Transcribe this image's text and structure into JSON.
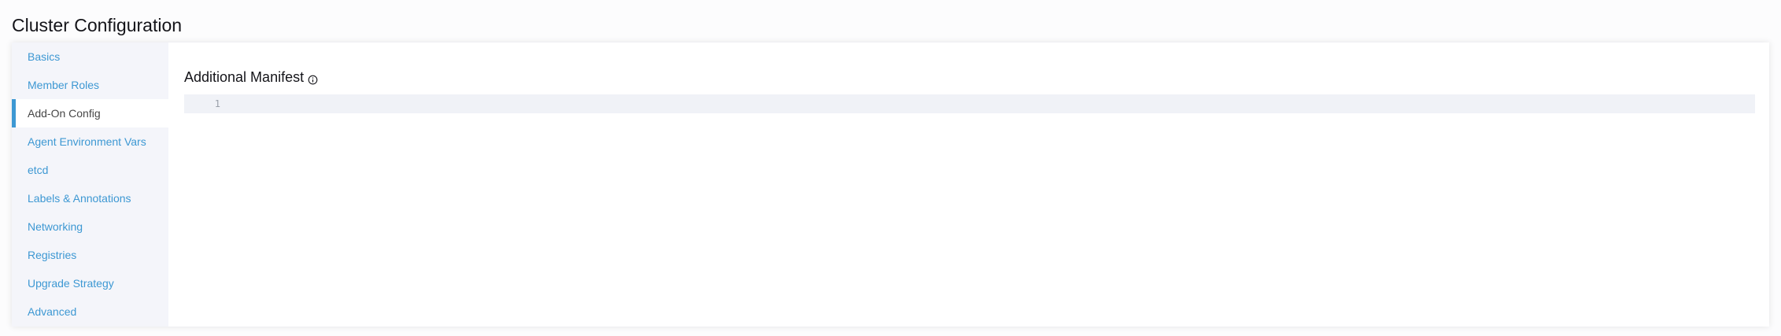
{
  "page": {
    "title": "Cluster Configuration"
  },
  "sidebar": {
    "items": [
      {
        "label": "Basics"
      },
      {
        "label": "Member Roles"
      },
      {
        "label": "Add-On Config"
      },
      {
        "label": "Agent Environment Vars"
      },
      {
        "label": "etcd"
      },
      {
        "label": "Labels & Annotations"
      },
      {
        "label": "Networking"
      },
      {
        "label": "Registries"
      },
      {
        "label": "Upgrade Strategy"
      },
      {
        "label": "Advanced"
      }
    ],
    "active_index": 2
  },
  "main": {
    "section_title": "Additional Manifest",
    "info_icon": "info-circle-icon",
    "editor": {
      "line_numbers": [
        "1"
      ],
      "content": ""
    }
  },
  "colors": {
    "accent": "#3d98d3",
    "sidebar_bg": "#f4f5fa",
    "editor_bg": "#f0f2f7",
    "text": "#141419"
  }
}
